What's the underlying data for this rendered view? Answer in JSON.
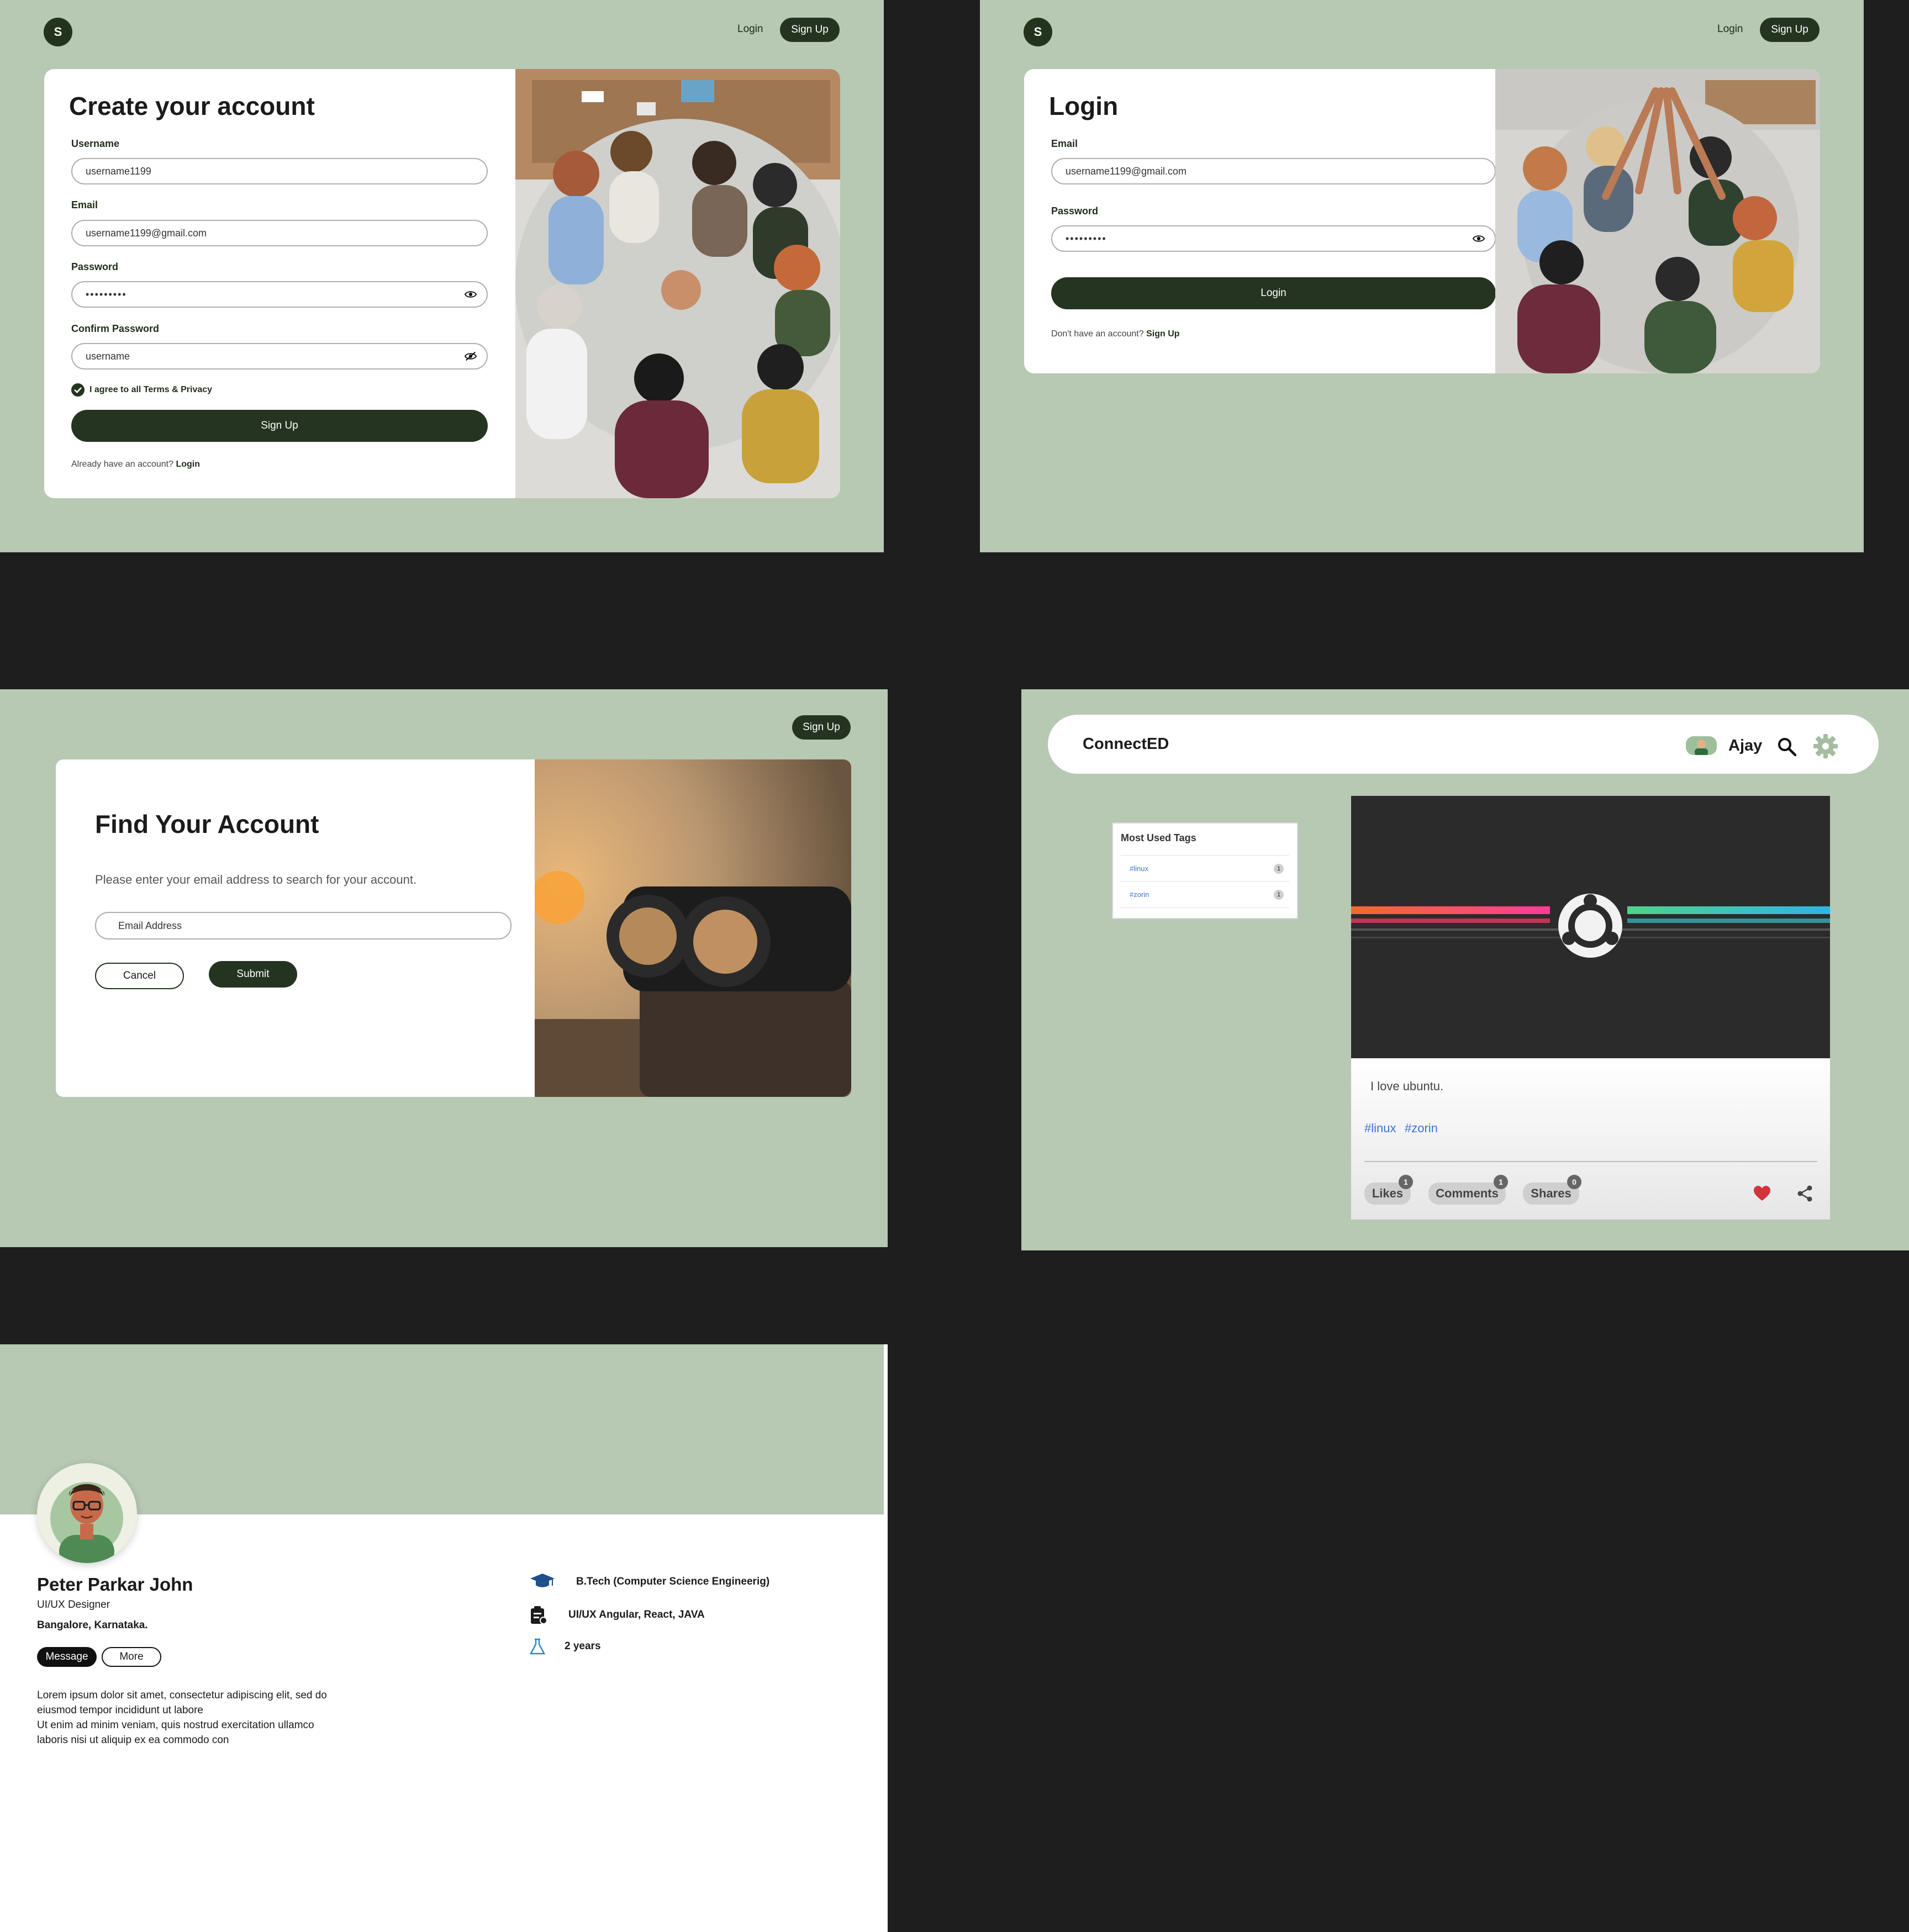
{
  "signup": {
    "logo": "S",
    "nav_login": "Login",
    "nav_signup": "Sign Up",
    "title": "Create your account",
    "username_label": "Username",
    "username_value": "username1199",
    "email_label": "Email",
    "email_value": "username1199@gmail.com",
    "password_label": "Password",
    "password_value": "•••••••••",
    "confirm_label": "Confirm Password",
    "confirm_value": "username",
    "terms": "I agree to all Terms & Privacy",
    "submit": "Sign Up",
    "footer_text": "Already have an account?",
    "footer_link": "Login"
  },
  "login": {
    "logo": "S",
    "nav_login": "Login",
    "nav_signup": "Sign Up",
    "title": "Login",
    "email_label": "Email",
    "email_value": "username1199@gmail.com",
    "password_label": "Password",
    "password_value": "•••••••••",
    "submit": "Login",
    "footer_text": "Don't have an account?",
    "footer_link": "Sign Up"
  },
  "find": {
    "nav_signup": "Sign Up",
    "title": "Find Your Account",
    "description": "Please enter your email address to search for your account.",
    "email_placeholder": "Email Address",
    "cancel": "Cancel",
    "submit": "Submit"
  },
  "feed": {
    "brand": "ConnectED",
    "user_name": "Ajay",
    "tags_title": "Most Used Tags",
    "tags": [
      {
        "name": "#linux",
        "count": "1"
      },
      {
        "name": "#zorin",
        "count": "1"
      }
    ],
    "post": {
      "text": "I love ubuntu.",
      "tag1": "#linux",
      "tag2": "#zorin",
      "likes_label": "Likes",
      "likes_count": "1",
      "comments_label": "Comments",
      "comments_count": "1",
      "shares_label": "Shares",
      "shares_count": "0"
    }
  },
  "profile": {
    "name": "Peter Parkar John",
    "role": "UI/UX Designer",
    "location": "Bangalore, Karnataka.",
    "message": "Message",
    "more": "More",
    "bio": [
      "Lorem ipsum dolor sit amet, consectetur adipiscing elit, sed do",
      "eiusmod tempor incididunt ut labore",
      "Ut enim ad minim veniam, quis nostrud exercitation ullamco",
      "laboris nisi ut aliquip ex ea commodo con"
    ],
    "education": "B.Tech (Computer Science Engineerig)",
    "skills": "UI/UX Angular, React, JAVA",
    "experience": "2 years"
  },
  "colors": {
    "sage": "#b7c8b3",
    "dark_green": "#243420",
    "canvas": "#1e1e1e",
    "tag_blue": "#3b73d6",
    "heart": "#d2343a"
  }
}
